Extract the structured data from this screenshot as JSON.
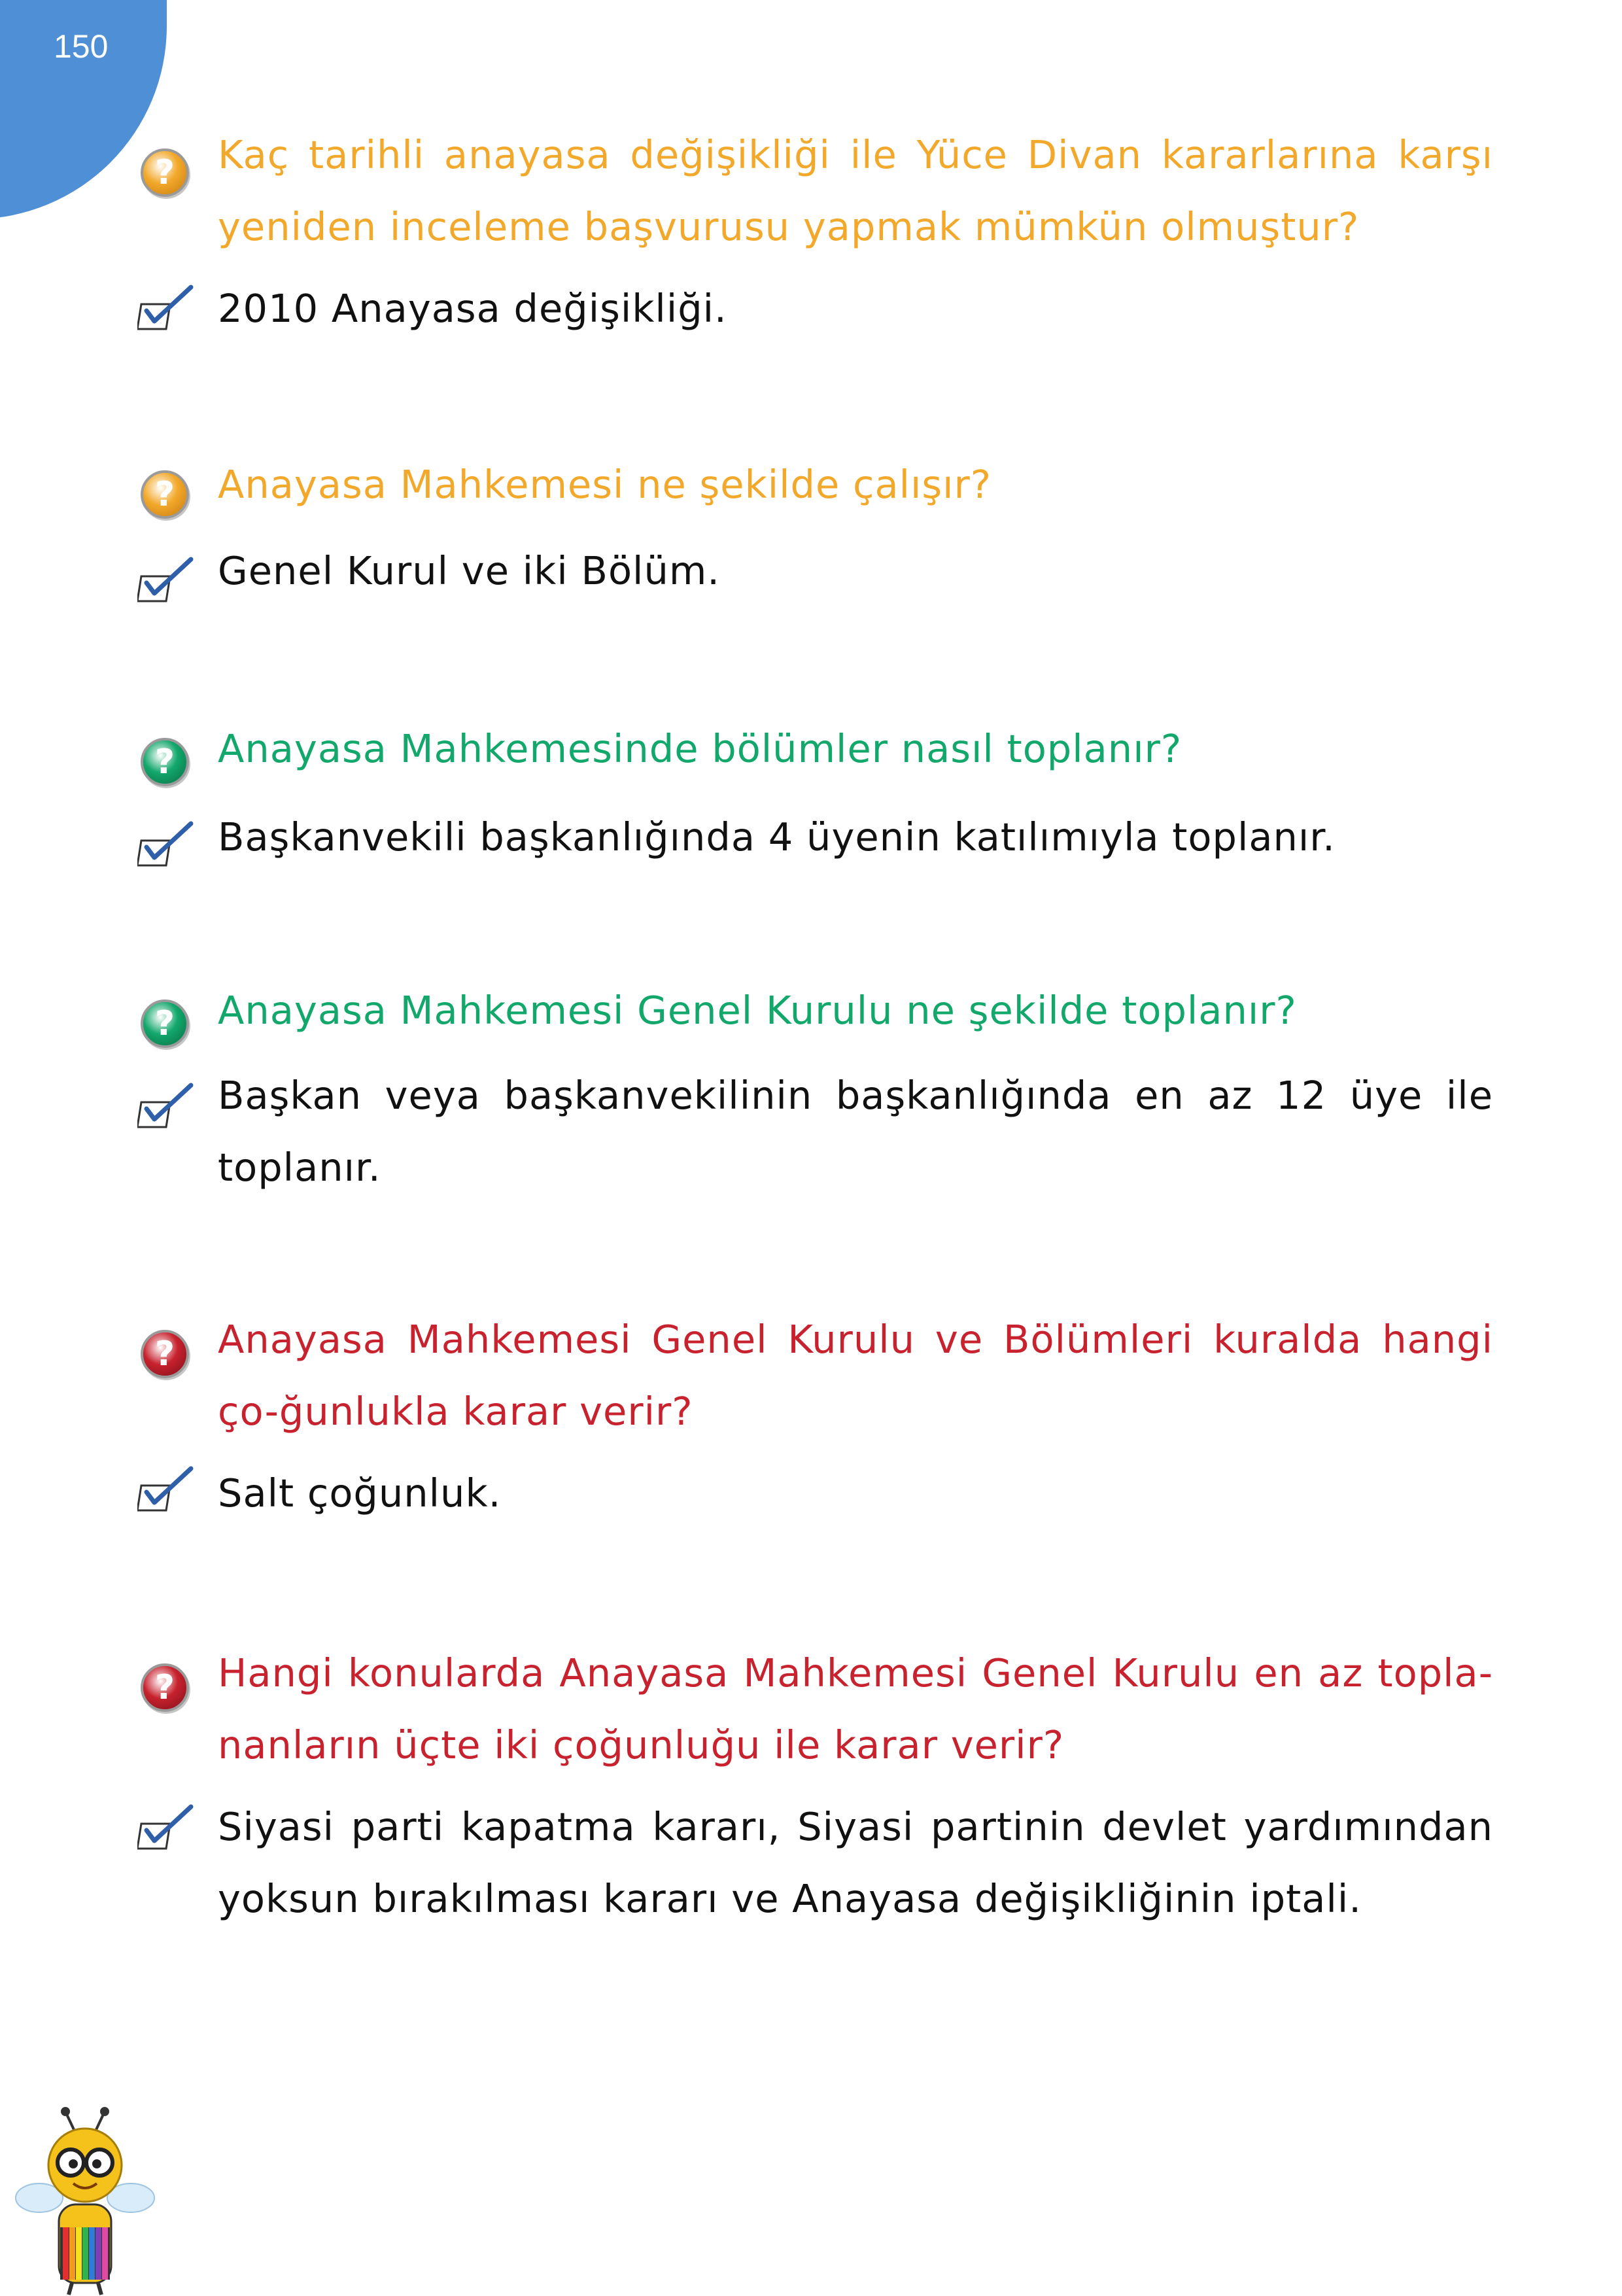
{
  "page_number": "150",
  "colors": {
    "orange": "#f2a92b",
    "green": "#12a76b",
    "red": "#c7222e",
    "corner_blue": "#4f8fd6"
  },
  "items": [
    {
      "color": "orange",
      "question": "Kaç tarihli anayasa değişikliği ile Yüce Divan kararlarına karşı yeniden inceleme başvurusu yapmak mümkün olmuştur?",
      "answer": "2010 Anayasa değişikliği."
    },
    {
      "color": "orange",
      "question": "Anayasa Mahkemesi ne şekilde çalışır?",
      "answer": "Genel Kurul ve iki Bölüm."
    },
    {
      "color": "green",
      "question": "Anayasa Mahkemesinde bölümler nasıl toplanır?",
      "answer": "Başkanvekili başkanlığında 4 üyenin katılımıyla toplanır."
    },
    {
      "color": "green",
      "question": "Anayasa Mahkemesi Genel Kurulu ne şekilde toplanır?",
      "answer": "Başkan veya başkanvekilinin başkanlığında en az 12 üye ile toplanır."
    },
    {
      "color": "red",
      "question": "Anayasa Mahkemesi Genel Kurulu ve Bölümleri kuralda hangi ço-ğunlukla karar verir?",
      "answer": "Salt çoğunluk."
    },
    {
      "color": "red",
      "question": "Hangi konularda Anayasa Mahkemesi Genel Kurulu en az topla-nanların üçte iki çoğunluğu ile karar verir?",
      "answer": "Siyasi parti kapatma kararı, Siyasi partinin devlet yardımından yoksun bırakılması kararı ve Anayasa değişikliğinin iptali."
    }
  ]
}
